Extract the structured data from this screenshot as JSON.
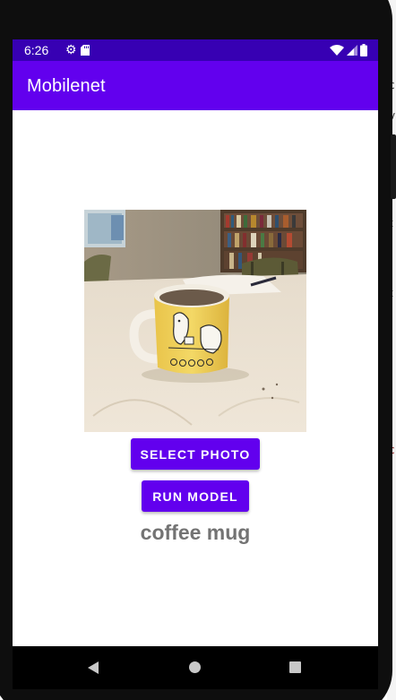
{
  "status_bar": {
    "time": "6:26",
    "icons": [
      "gear-icon",
      "sd-card-icon",
      "wifi-icon",
      "cellular-signal-icon",
      "battery-icon"
    ]
  },
  "app_bar": {
    "title": "Mobilenet"
  },
  "main": {
    "photo_description": "coffee-mug-photo",
    "select_photo_label": "SELECT PHOTO",
    "run_model_label": "RUN MODEL",
    "prediction": "coffee mug"
  },
  "nav_bar": {
    "icons": [
      "back-icon",
      "home-icon",
      "recents-icon"
    ]
  },
  "colors": {
    "status_bar": "#3700b3",
    "app_bar": "#6200ee",
    "button": "#6200ee",
    "result_text": "#737373"
  }
}
